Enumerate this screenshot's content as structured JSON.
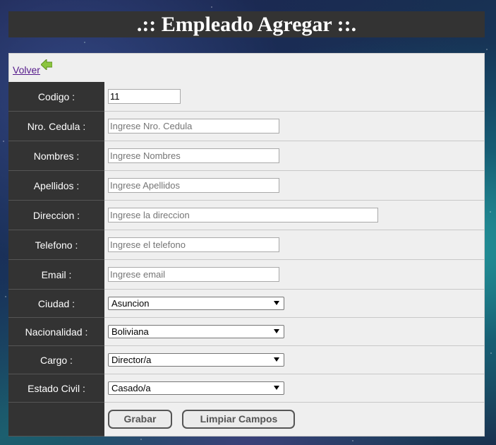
{
  "page": {
    "title": ".:: Empleado Agregar ::.",
    "back_label": "Volver "
  },
  "form": {
    "codigo": {
      "label": "Codigo :",
      "value": "11"
    },
    "cedula": {
      "label": "Nro. Cedula :",
      "placeholder": "Ingrese Nro. Cedula"
    },
    "nombres": {
      "label": "Nombres :",
      "placeholder": "Ingrese Nombres"
    },
    "apellidos": {
      "label": "Apellidos :",
      "placeholder": "Ingrese Apellidos"
    },
    "direccion": {
      "label": "Direccion :",
      "placeholder": "Ingrese la direccion"
    },
    "telefono": {
      "label": "Telefono :",
      "placeholder": "Ingrese el telefono"
    },
    "email": {
      "label": "Email :",
      "placeholder": "Ingrese email"
    },
    "ciudad": {
      "label": "Ciudad :",
      "selected": "Asuncion"
    },
    "nacionalidad": {
      "label": "Nacionalidad :",
      "selected": "Boliviana"
    },
    "cargo": {
      "label": "Cargo :",
      "selected": "Director/a"
    },
    "estado_civil": {
      "label": "Estado Civil :",
      "selected": "Casado/a"
    }
  },
  "actions": {
    "save_label": "Grabar",
    "clear_label": "Limpiar Campos"
  },
  "icons": {
    "back": "arrow-left-icon"
  },
  "colors": {
    "header_bg": "#333333",
    "label_bg": "#333333",
    "field_bg": "#efefef",
    "link": "#551a8b",
    "back_arrow": "#8cc63f"
  }
}
